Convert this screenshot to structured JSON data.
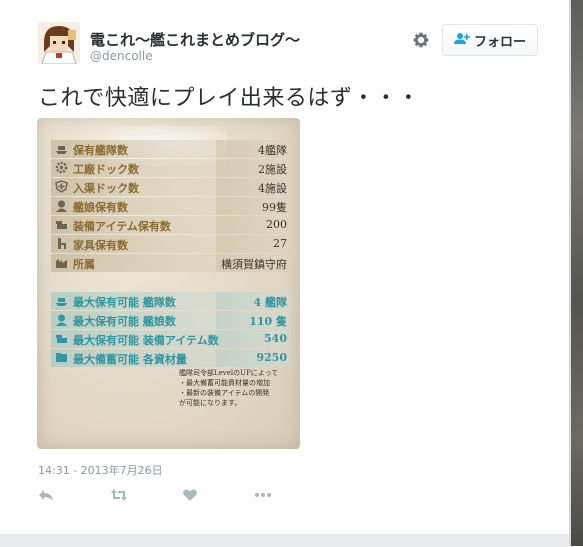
{
  "tweet": {
    "author_name": "電これ〜艦これまとめブログ〜",
    "author_handle": "@dencolle",
    "follow_label": "フォロー",
    "text": "これで快適にプレイ出来るはず・・・",
    "timestamp": "14:31 - 2013年7月26日"
  },
  "media": {
    "stats": [
      {
        "label": "保有艦隊数",
        "value": "4艦隊",
        "icon": "fleet-icon"
      },
      {
        "label": "工廠ドック数",
        "value": "2施設",
        "icon": "arsenal-gear-icon"
      },
      {
        "label": "入渠ドック数",
        "value": "4施設",
        "icon": "repair-dock-icon"
      },
      {
        "label": "艦娘保有数",
        "value": "99隻",
        "icon": "shipgirl-icon"
      },
      {
        "label": "装備アイテム保有数",
        "value": "200",
        "icon": "equipment-icon"
      },
      {
        "label": "家具保有数",
        "value": "27",
        "icon": "furniture-icon"
      },
      {
        "label": "所属",
        "value": "横須賀鎮守府",
        "icon": "base-icon"
      }
    ],
    "max_stats": [
      {
        "label": "最大保有可能 艦隊数",
        "value": "4 艦隊",
        "icon": "fleet-icon"
      },
      {
        "label": "最大保有可能 艦娘数",
        "value": "110 隻",
        "icon": "shipgirl-icon"
      },
      {
        "label": "最大保有可能 装備アイテム数",
        "value": "540",
        "icon": "equipment-icon"
      },
      {
        "label": "最大備蓄可能 各資材量",
        "value": "9250",
        "icon": "materials-icon"
      }
    ],
    "note_lines": [
      "艦隊司令部LevelのUPによって",
      "・最大備蓄可能資材量の増加",
      "・最新の装備アイテムの開発",
      "が可能になります。"
    ]
  },
  "colors": {
    "accent_gold": "#8a6c2e",
    "accent_teal": "#2f97a3",
    "muted": "#8899a6"
  }
}
